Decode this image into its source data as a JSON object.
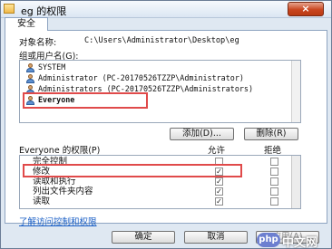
{
  "window": {
    "title": "eg 的权限",
    "close_label": "×"
  },
  "tabs": [
    {
      "label": "安全"
    }
  ],
  "security": {
    "object_name_label": "对象名称:",
    "object_name_value": "C:\\Users\\Administrator\\Desktop\\eg",
    "group_list_label": "组或用户名(G):",
    "groups": [
      {
        "name": "SYSTEM",
        "icon": "user-icon"
      },
      {
        "name": "Administrator (PC-20170526TZZP\\Administrator)",
        "icon": "user-icon"
      },
      {
        "name": "Administrators (PC-20170526TZZP\\Administrators)",
        "icon": "user-icon"
      },
      {
        "name": "Everyone",
        "icon": "user-icon",
        "highlighted": true
      }
    ],
    "add_button": "添加(D)...",
    "remove_button": "删除(R)",
    "permissions_label": "Everyone 的权限(P)",
    "allow_header": "允许",
    "deny_header": "拒绝",
    "permissions": [
      {
        "name": "完全控制",
        "allow": false,
        "deny": false
      },
      {
        "name": "修改",
        "allow": true,
        "deny": false,
        "highlighted": true
      },
      {
        "name": "读取和执行",
        "allow": true,
        "deny": false
      },
      {
        "name": "列出文件夹内容",
        "allow": true,
        "deny": false
      },
      {
        "name": "读取",
        "allow": true,
        "deny": false
      }
    ],
    "advanced_link": "了解访问控制和权限"
  },
  "footer": {
    "ok_button": "确定",
    "cancel_button": "取消",
    "apply_button": "应用(A)"
  },
  "watermark": {
    "logo_text": "php",
    "site_text": "中文网"
  }
}
